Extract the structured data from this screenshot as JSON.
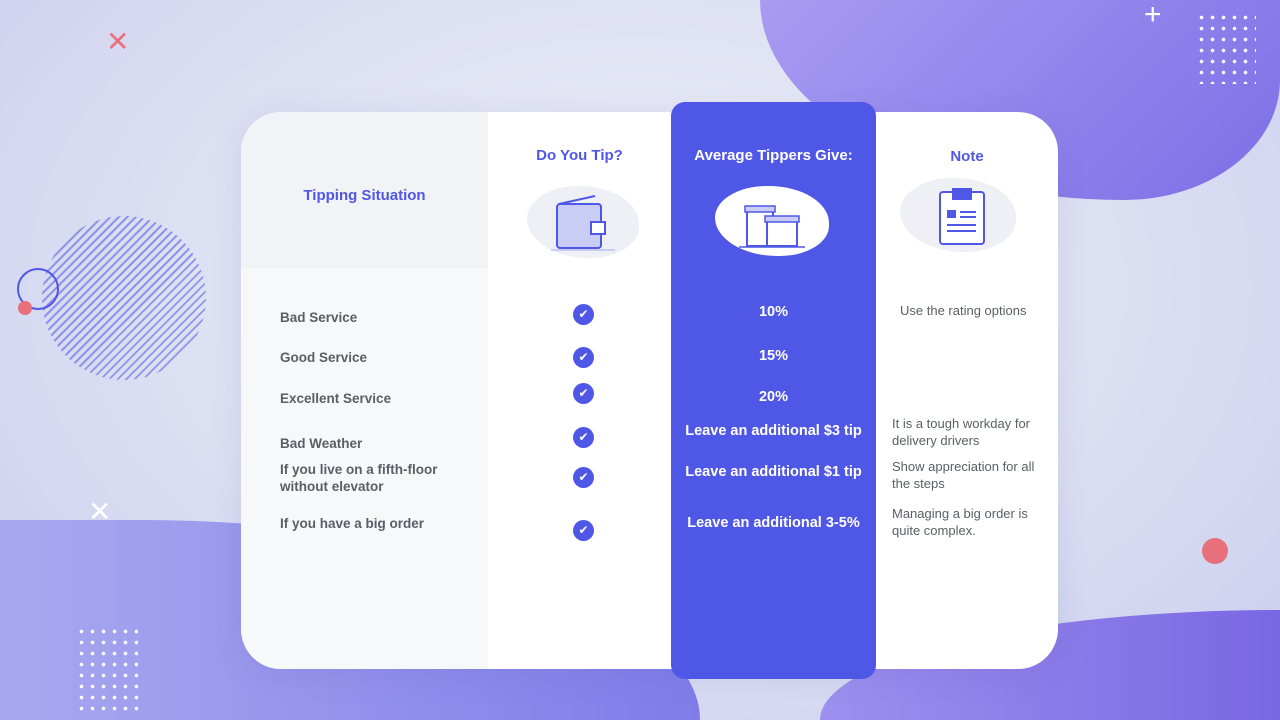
{
  "colors": {
    "accent": "#4f57e6",
    "text": "#5b5e66",
    "panel": "#f6f8f9"
  },
  "headers": {
    "situation": "Tipping Situation",
    "do_you_tip": "Do You Tip?",
    "average": "Average Tippers Give:",
    "note": "Note"
  },
  "icons": {
    "do_you_tip": "wallet-icon",
    "average": "gift-boxes-icon",
    "note": "clipboard-icon",
    "check": "check-circle-icon"
  },
  "rows": [
    {
      "situation": "Bad Service",
      "tip": true,
      "average": "10%",
      "note": "Use the rating options"
    },
    {
      "situation": "Good Service",
      "tip": true,
      "average": "15%",
      "note": ""
    },
    {
      "situation": "Excellent Service",
      "tip": true,
      "average": "20%",
      "note": ""
    },
    {
      "situation": "Bad Weather",
      "tip": true,
      "average": "Leave an additional $3 tip",
      "note": "It is a tough workday for delivery drivers"
    },
    {
      "situation": "If you live on a fifth-floor without elevator",
      "tip": true,
      "average": "Leave an additional $1 tip",
      "note": "Show appreciation for all the steps"
    },
    {
      "situation": "If you have a big order",
      "tip": true,
      "average": "Leave an additional 3-5%",
      "note": "Managing a big order is quite complex."
    }
  ]
}
